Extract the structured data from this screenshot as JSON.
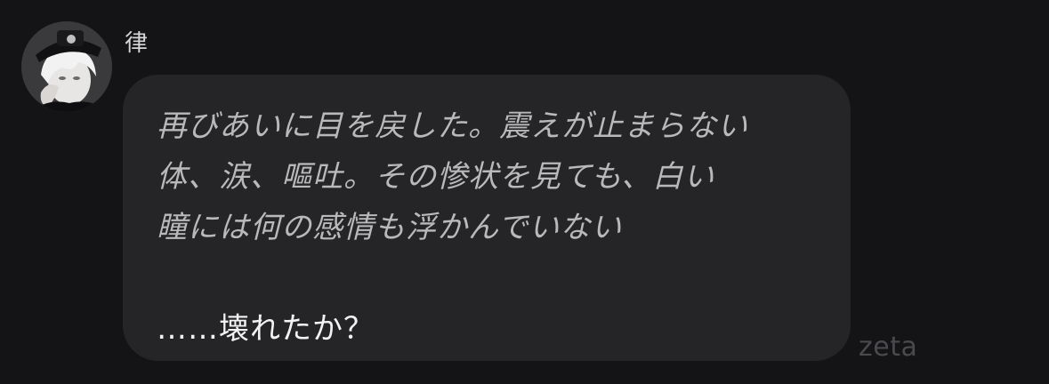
{
  "chat": {
    "sender_name": "律",
    "message": {
      "narration_lines": [
        "再びあいに目を戻した。震えが止まらない",
        "体、涙、嘔吐。その惨状を見ても、白い",
        "瞳には何の感情も浮かんでいない"
      ],
      "dialogue": "……壊れたか？"
    }
  },
  "watermark": "zeta"
}
